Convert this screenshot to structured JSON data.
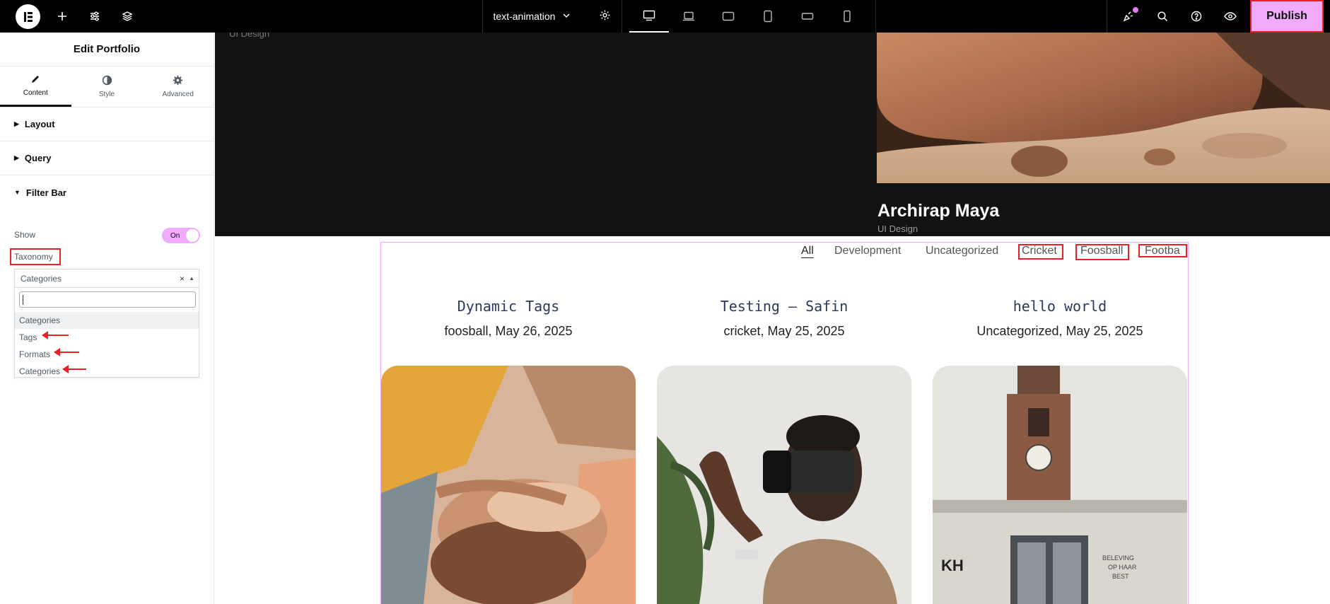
{
  "topbar": {
    "document_title": "text-animation",
    "publish_label": "Publish",
    "icons": [
      "elementor-logo-icon",
      "plus-icon",
      "sliders-icon",
      "layers-icon",
      "chevron-down-icon",
      "gear-icon",
      "desktop-icon",
      "laptop-icon",
      "tablet-landscape-icon",
      "tablet-portrait-icon",
      "mobile-landscape-icon",
      "mobile-portrait-icon",
      "whats-new-icon",
      "search-icon",
      "help-icon",
      "preview-eye-icon"
    ]
  },
  "panel": {
    "title": "Edit Portfolio",
    "tabs": [
      {
        "label": "Content",
        "icon": "pencil-icon",
        "active": true
      },
      {
        "label": "Style",
        "icon": "contrast-icon",
        "active": false
      },
      {
        "label": "Advanced",
        "icon": "gear-icon",
        "active": false
      }
    ],
    "sections": [
      "Layout",
      "Query",
      "Filter Bar"
    ],
    "show_label": "Show",
    "toggle_label": "On",
    "taxonomy_label": "Taxonomy",
    "select_value": "Categories",
    "select_clear": "×",
    "dropdown_items": [
      "Categories",
      "Tags",
      "Formats",
      "Categories"
    ]
  },
  "canvas": {
    "hero_sub_left": "UI Design",
    "hero_title": "Archirap Maya",
    "hero_sub": "UI Design",
    "filters": [
      "All",
      "Development",
      "Uncategorized",
      "Cricket",
      "Foosball",
      "Footba"
    ],
    "cards": [
      {
        "title": "Dynamic Tags",
        "meta": "foosball,  May 26, 2025"
      },
      {
        "title": "Testing – Safin",
        "meta": "cricket,  May 25, 2025"
      },
      {
        "title": "hello world",
        "meta": "Uncategorized,  May 25, 2025"
      }
    ]
  },
  "colors": {
    "accent": "#f0abfc",
    "annotation": "#e8202a",
    "topbar": "#000000",
    "hero": "#121212"
  }
}
